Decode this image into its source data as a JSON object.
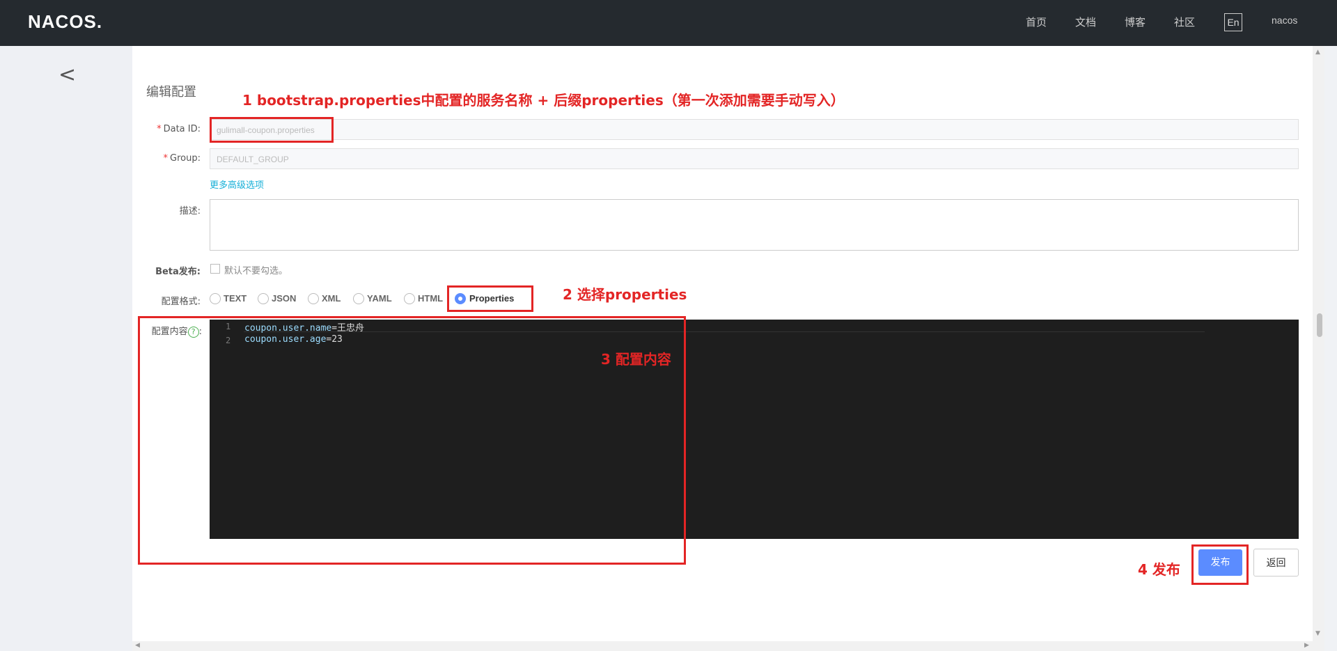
{
  "header": {
    "logo": "NACOS.",
    "nav": [
      "首页",
      "文档",
      "博客",
      "社区"
    ],
    "lang": "En",
    "user": "nacos"
  },
  "page": {
    "title": "编辑配置"
  },
  "form": {
    "data_id_label": "Data ID:",
    "data_id_value": "gulimall-coupon.properties",
    "group_label": "Group:",
    "group_value": "DEFAULT_GROUP",
    "advanced_link": "更多高级选项",
    "desc_label": "描述:",
    "beta_label": "Beta发布:",
    "beta_hint": "默认不要勾选。",
    "format_label": "配置格式:",
    "formats": [
      "TEXT",
      "JSON",
      "XML",
      "YAML",
      "HTML",
      "Properties"
    ],
    "selected_format": "Properties",
    "content_label": "配置内容",
    "help_icon": "?",
    "content_colon": ":"
  },
  "editor": {
    "lines": [
      {
        "num": "1",
        "key": "coupon.user.name",
        "value": "=王忠舟"
      },
      {
        "num": "2",
        "key": "coupon.user.age",
        "value": "=23"
      }
    ]
  },
  "buttons": {
    "publish": "发布",
    "back": "返回"
  },
  "annotations": {
    "a1": "1 bootstrap.properties中配置的服务名称 + 后缀properties（第一次添加需要手动写入）",
    "a2": "2 选择properties",
    "a3": "3 配置内容",
    "a4": "4 发布",
    "color": "#e32525"
  },
  "colors": {
    "header_bg": "#252a2f",
    "primary": "#5b8cff",
    "link": "#18b0d8"
  }
}
